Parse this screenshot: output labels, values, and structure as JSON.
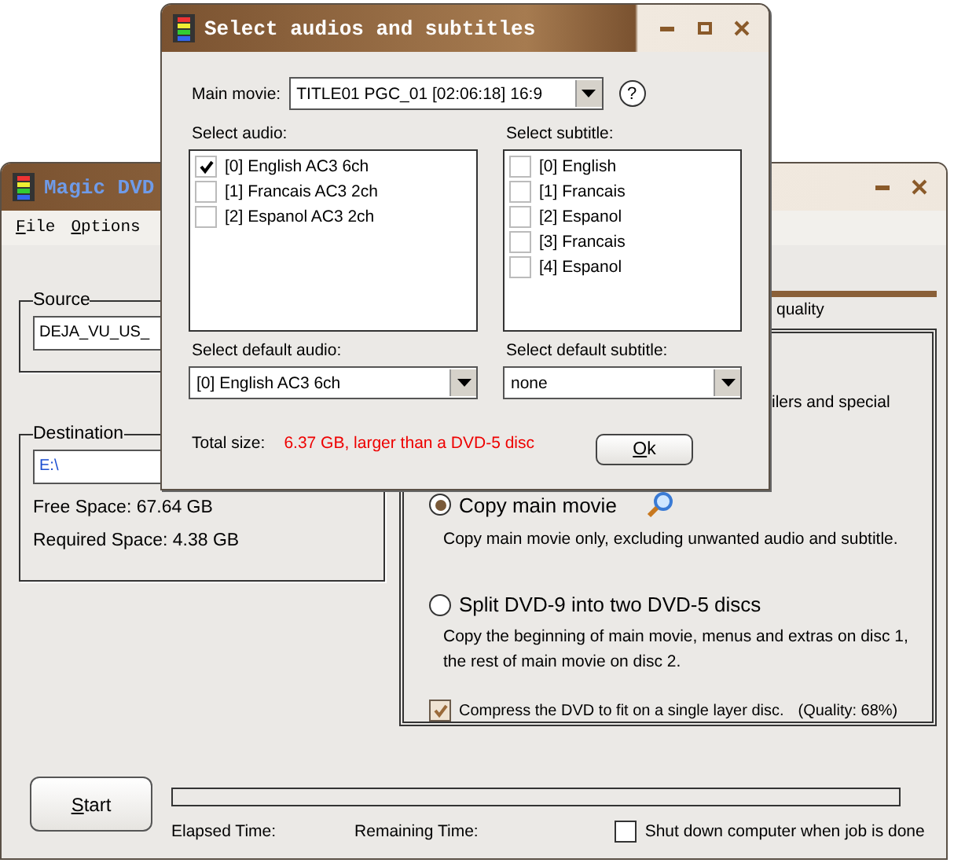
{
  "main": {
    "title": "Magic DVD",
    "menu": [
      "File",
      "Options"
    ],
    "source_label": "Source",
    "source_path": "DEJA_VU_US_",
    "destination_label": "Destination",
    "destination_path": "E:\\",
    "free_space": "Free Space: 67.64 GB",
    "required_space": "Required Space: 4.38 GB",
    "tab_fragment": "quality",
    "desc_fragment": "ilers and special",
    "modes": [
      {
        "label": "Copy main movie",
        "desc": "Copy main movie only, excluding unwanted audio and subtitle.",
        "selected": true
      },
      {
        "label": "Split DVD-9 into two DVD-5 discs",
        "desc": "Copy the beginning of main movie, menus and extras on disc 1, the rest of main movie on disc 2.",
        "selected": false
      }
    ],
    "compress": {
      "label": "Compress the DVD to fit on a single layer disc.",
      "checked": true,
      "quality": "(Quality: 68%)"
    },
    "start": "Start",
    "progress": {
      "level": 0
    },
    "elapsed": "Elapsed Time:",
    "remaining": "Remaining Time:",
    "shutdown": {
      "label": "Shut down computer when job is done",
      "checked": false
    }
  },
  "dialog": {
    "title": "Select audios and subtitles",
    "main_movie_label": "Main movie:",
    "main_movie": "TITLE01 PGC_01 [02:06:18] 16:9",
    "help": "?",
    "audio_label": "Select audio:",
    "audio": [
      {
        "label": "[0] English AC3 6ch",
        "checked": true
      },
      {
        "label": "[1] Francais AC3 2ch",
        "checked": false
      },
      {
        "label": "[2] Espanol AC3 2ch",
        "checked": false
      }
    ],
    "subtitle_label": "Select subtitle:",
    "subtitles": [
      {
        "label": "[0] English",
        "checked": false
      },
      {
        "label": "[1] Francais",
        "checked": false
      },
      {
        "label": "[2] Espanol",
        "checked": false
      },
      {
        "label": "[3] Francais",
        "checked": false
      },
      {
        "label": "[4] Espanol",
        "checked": false
      }
    ],
    "default_audio_label": "Select default audio:",
    "default_audio": "[0] English AC3 6ch",
    "default_subtitle_label": "Select default subtitle:",
    "default_subtitle": "none",
    "total_label": "Total size:",
    "total_value": "6.37 GB, larger than a DVD-5 disc",
    "ok": "Ok"
  }
}
